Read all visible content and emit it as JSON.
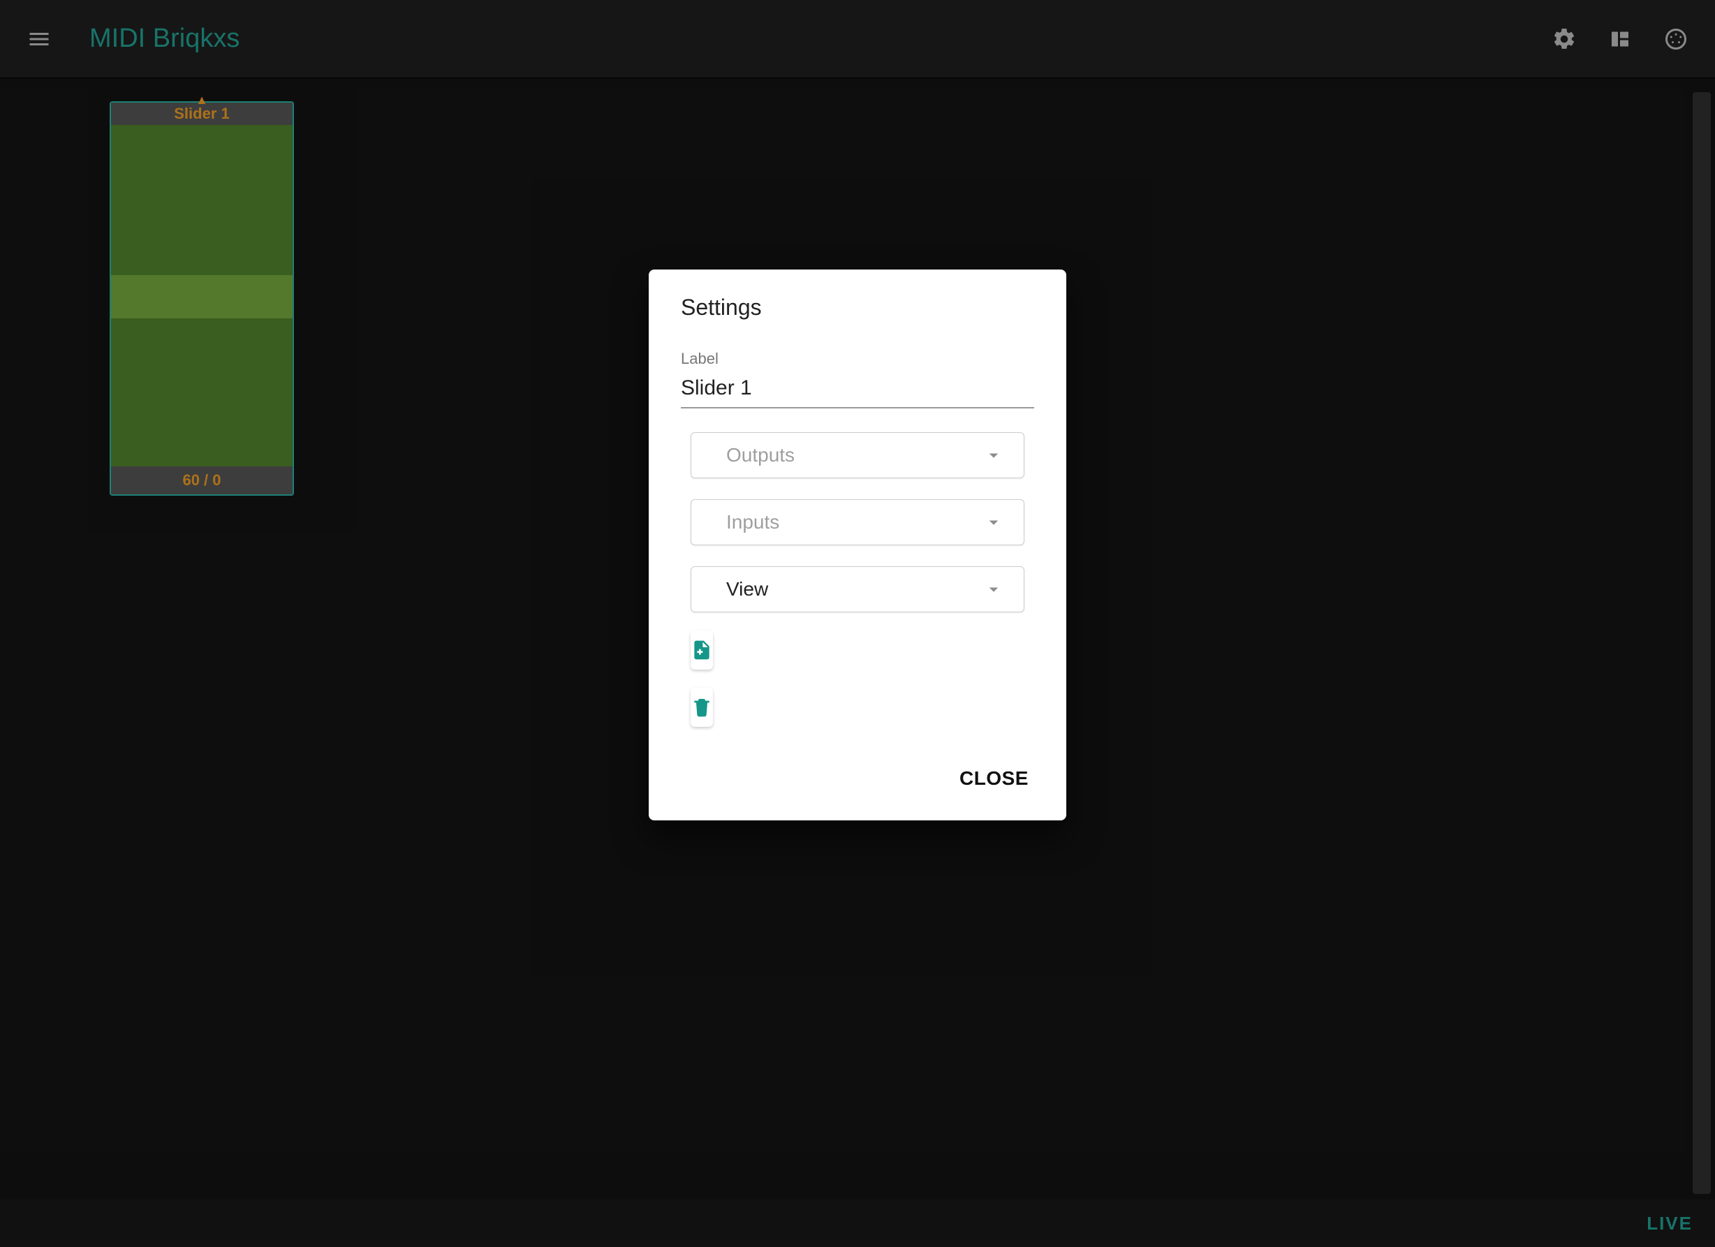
{
  "appbar": {
    "title": "MIDI Briqkxs",
    "icons": {
      "menu": "menu-icon",
      "settings": "gear-icon",
      "layout": "view-quilt-icon",
      "midi": "midi-port-icon"
    }
  },
  "slider": {
    "top_label": "Slider 1",
    "bottom_label": "60 / 0"
  },
  "footer": {
    "live": "LIVE"
  },
  "dialog": {
    "title": "Settings",
    "label_caption": "Label",
    "label_value": "Slider 1",
    "panels": {
      "outputs": "Outputs",
      "inputs": "Inputs",
      "view": "View"
    },
    "close": "CLOSE"
  },
  "colors": {
    "accent": "#24aa9b",
    "slider_fill": "#558b2f",
    "slider_thumb": "#7cb342",
    "slider_text": "#ffa726"
  }
}
